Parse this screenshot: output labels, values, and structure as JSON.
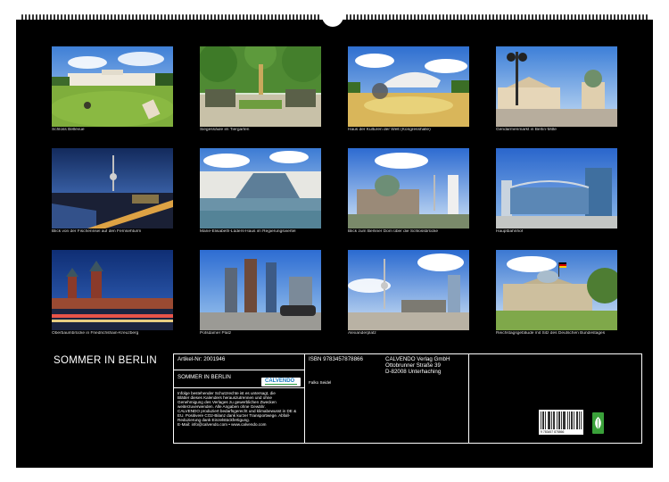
{
  "calendar": {
    "title": "SOMMER IN BERLIN",
    "photos": [
      {
        "caption": "Schloss Bellevue"
      },
      {
        "caption": "Siegessäule im Tiergarten"
      },
      {
        "caption": "Haus der Kulturen der Welt (Kongresshalle)"
      },
      {
        "caption": "Gendarmenmarkt in Berlin-Mitte"
      },
      {
        "caption": "Blick von der Fischerinsel auf den Fernsehturm"
      },
      {
        "caption": "Marie-Elisabeth-Lüders-Haus im Regierungsviertel"
      },
      {
        "caption": "Blick zum Berliner Dom über die Schlossbrücke"
      },
      {
        "caption": "Hauptbahnhof"
      },
      {
        "caption": "Oberbaumbrücke in Friedrichshain-Kreuzberg"
      },
      {
        "caption": "Potsdamer Platz"
      },
      {
        "caption": "Alexanderplatz"
      },
      {
        "caption": "Reichstagsgebäude mit Sitz des Deutschen Bundestages"
      }
    ]
  },
  "info": {
    "article": "Artikel-Nr: 2001946",
    "logo": "CALVENDO",
    "title": "SOMMER IN BERLIN",
    "disclaimer": [
      "Infolge bestehender Schutzrechte ist es untersagt, die",
      "Blätter dieses Kalenders herauszutrennen und ohne",
      "Genehmigung des Verlages zu gewerblichen Zwecken",
      "weiterzuverwenden. Alle Angaben ohne Gewähr.",
      "CALVENDO produziert bedarfsgerecht und klimabewusst in DE &",
      "EU. Positivere CO2-Bilanz dank kurzer Transportwege. Abfall-",
      "Reduzierung dank Einzelstückfertigung.",
      "E-Mail: info@calvendo.com • www.calvendo.com"
    ],
    "isbn": "ISBN 9783457878866",
    "author": "Falko Seidel",
    "publisher": [
      "CALVENDO Verlag GmbH",
      "Ottobrunner Straße 39",
      "D-82008 Unterhaching"
    ],
    "barcode_number": "9 783457 878866"
  }
}
